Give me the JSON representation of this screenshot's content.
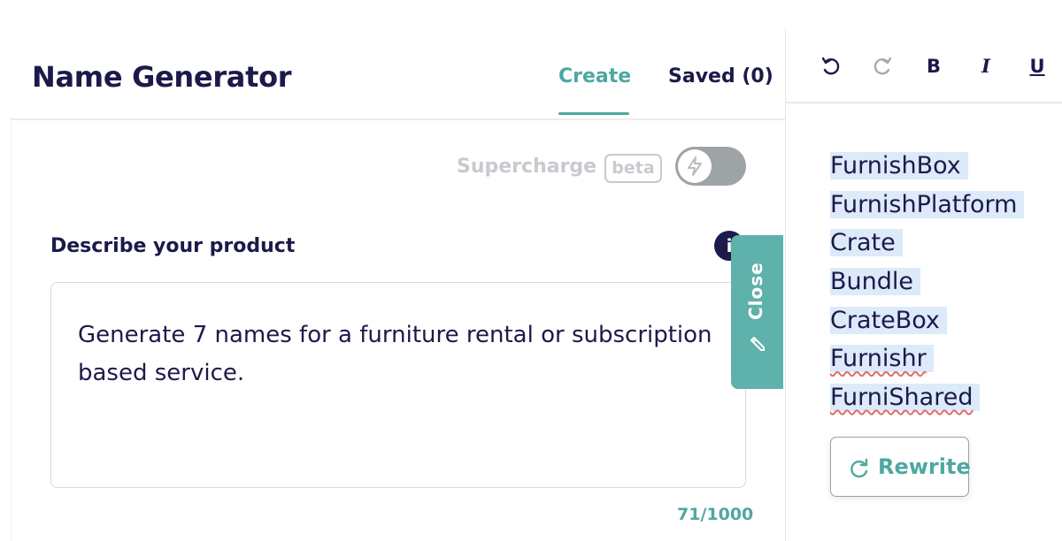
{
  "app": {
    "title": "Name Generator"
  },
  "tabs": [
    {
      "label": "Create",
      "active": true
    },
    {
      "label": "Saved (0)",
      "active": false
    }
  ],
  "supercharge": {
    "label": "Supercharge",
    "badge": "beta",
    "enabled": false,
    "icon": "lightning-icon"
  },
  "form": {
    "label": "Describe your product",
    "info_icon": "i",
    "value": "Generate 7 names for a furniture rental or subscription based service.",
    "char_count": "71/1000"
  },
  "close_tab": {
    "label": "Close",
    "icon": "pencil-icon"
  },
  "toolbar": {
    "undo_icon": "undo-icon",
    "redo_icon": "redo-icon",
    "bold": "B",
    "italic": "I",
    "underline": "U"
  },
  "results": {
    "names": [
      "FurnishBox",
      "FurnishPlatform",
      "Crate",
      "Bundle",
      "CrateBox",
      "Furnishr",
      "FurniShared"
    ],
    "rewrite_label": "Rewrite",
    "rewrite_icon": "refresh-icon"
  },
  "colors": {
    "accent": "#4fa7a1",
    "close_tab": "#5fb1ab",
    "text": "#1c1a4a",
    "highlight": "#dceaf9"
  }
}
